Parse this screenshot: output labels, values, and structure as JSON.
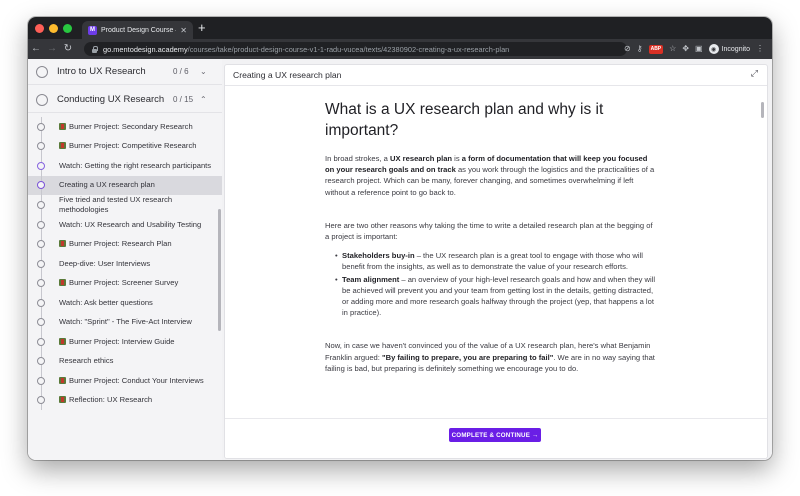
{
  "browser": {
    "tab_title": "Product Design Course – V1.1",
    "tab_favicon_letter": "M",
    "tab_close": "✕",
    "new_tab": "+",
    "url_host": "go.mentodesign.academy",
    "url_path": "/courses/take/product-design-course-v1-1-radu-vucea/texts/42380902-creating-a-ux-research-plan",
    "extension_badge": "ABP",
    "profile_label": "Incognito",
    "accent_colors": {
      "close": "#fe5f57",
      "minimize": "#febc2e",
      "maximize": "#28c840"
    }
  },
  "sidebar": {
    "modules": [
      {
        "title": "Intro to UX Research",
        "count": "0 / 6",
        "chevron": "⌄"
      },
      {
        "title": "Conducting UX Research",
        "count": "0 / 15",
        "chevron": "⌃"
      }
    ],
    "lessons": [
      {
        "label": "Burner Project: Secondary Research",
        "book": true
      },
      {
        "label": "Burner Project: Competitive Research",
        "book": true
      },
      {
        "label": "Watch: Getting the right research participants",
        "book": false,
        "watched": true
      },
      {
        "label": "Creating a UX research plan",
        "book": false,
        "active": true
      },
      {
        "label": "Five tried and tested UX research methodologies",
        "book": false
      },
      {
        "label": "Watch: UX Research and Usability Testing",
        "book": false
      },
      {
        "label": "Burner Project: Research Plan",
        "book": true
      },
      {
        "label": "Deep-dive: User Interviews",
        "book": false
      },
      {
        "label": "Burner Project: Screener Survey",
        "book": true
      },
      {
        "label": "Watch: Ask better questions",
        "book": false
      },
      {
        "label": "Watch: \"Sprint\" - The Five-Act Interview",
        "book": false
      },
      {
        "label": "Burner Project: Interview Guide",
        "book": true
      },
      {
        "label": "Research ethics",
        "book": false
      },
      {
        "label": "Burner Project: Conduct Your Interviews",
        "book": true
      },
      {
        "label": "Reflection: UX Research",
        "book": true
      }
    ]
  },
  "content": {
    "header_title": "Creating a UX research plan",
    "heading": "What is a UX research plan and why is it important?",
    "intro": {
      "p1": "In broad strokes, a ",
      "b1": "UX research plan",
      "p2": " is ",
      "b2": "a form of documentation that will keep you focused on your research goals and on track",
      "p3": " as you work through the logistics and the practicalities of a research project. Which can be many, forever changing, and sometimes overwhelming if left without a reference point to go back to."
    },
    "reasons_intro": "Here are two other reasons why taking the time to write a detailed research plan at the begging of a project is important:",
    "bullets": [
      {
        "title": "Stakeholders buy-in",
        "text": " – the UX research plan is a great tool to engage with those who will benefit from the insights, as well as to demonstrate the value of your research efforts."
      },
      {
        "title": "Team alignment",
        "text": " – an overview of your high-level research goals and how and when they will be achieved will prevent you and your team from getting lost in the details, getting distracted, or adding more and more research goals halfway through the project (yep, that happens a lot in practice)."
      }
    ],
    "quote_paragraph": {
      "p1": "Now, in case we haven't convinced you of the value of a UX research plan, here's what Benjamin Franklin argued: ",
      "quote": "\"By failing to prepare, you are preparing to fail\"",
      "p2": ". We are in no way saying that failing is bad, but preparing is definitely something we encourage you to do."
    },
    "complete_button": "COMPLETE & CONTINUE →"
  }
}
